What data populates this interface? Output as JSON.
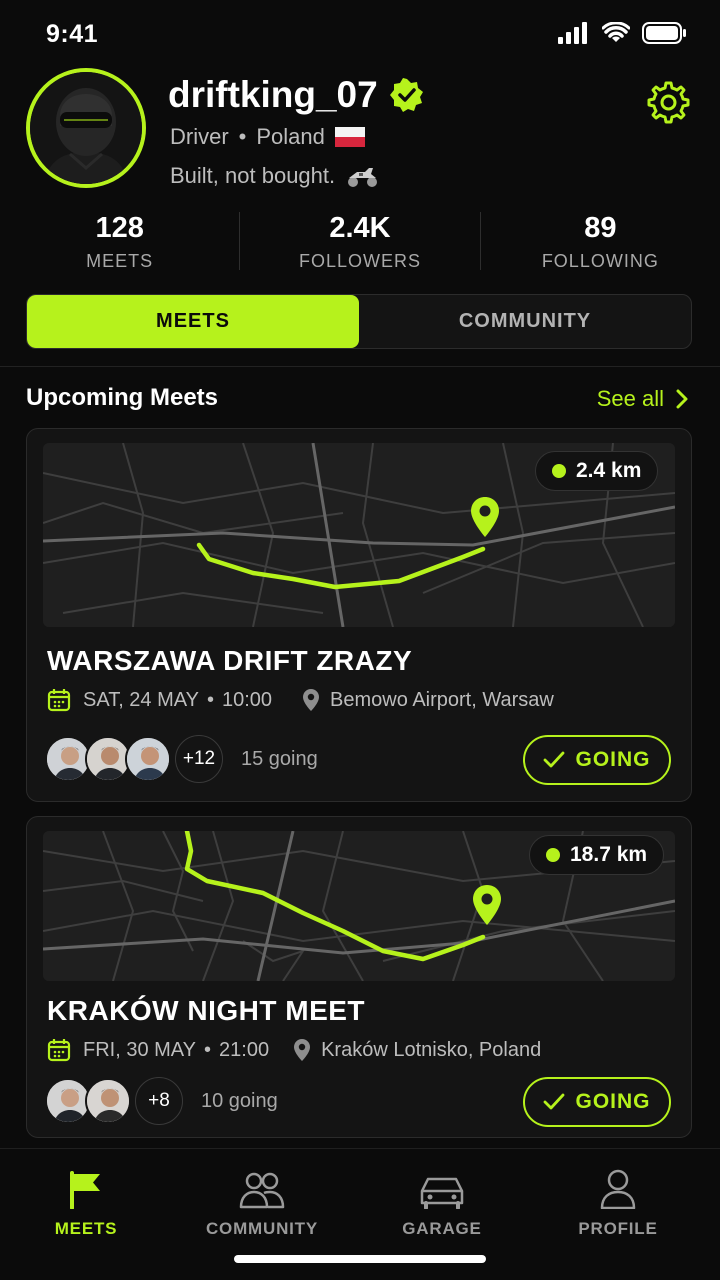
{
  "status_bar": {
    "time": "9:41"
  },
  "profile": {
    "username": "driftking_07",
    "role": "Driver",
    "country": "Poland",
    "bio": "Built, not bought."
  },
  "stats": [
    {
      "value": "128",
      "label": "MEETS"
    },
    {
      "value": "2.4K",
      "label": "FOLLOWERS"
    },
    {
      "value": "89",
      "label": "FOLLOWING"
    }
  ],
  "tabs": [
    {
      "label": "MEETS",
      "active": true
    },
    {
      "label": "COMMUNITY",
      "active": false
    }
  ],
  "section": {
    "title": "Upcoming Meets",
    "see_all": "See all"
  },
  "meets": [
    {
      "distance": "2.4 km",
      "title": "WARSZAWA DRIFT ZRAZY",
      "date": "SAT, 24 MAY",
      "time": "10:00",
      "location": "Bemowo Airport, Warsaw",
      "extra_count": "+12",
      "going_text": "15 going",
      "button": "GOING"
    },
    {
      "distance": "18.7 km",
      "title": "KRAKÓW NIGHT MEET",
      "date": "FRI, 30 MAY",
      "time": "21:00",
      "location": "Kraków Lotnisko, Poland",
      "extra_count": "+8",
      "going_text": "10 going",
      "button": "GOING"
    }
  ],
  "nav": [
    {
      "label": "MEETS",
      "icon": "flag-icon",
      "active": true
    },
    {
      "label": "COMMUNITY",
      "icon": "people-icon",
      "active": false
    },
    {
      "label": "GARAGE",
      "icon": "car-icon",
      "active": false
    },
    {
      "label": "PROFILE",
      "icon": "person-icon",
      "active": false
    }
  ],
  "colors": {
    "accent": "#b6f21c",
    "background": "#0b0b0b",
    "card": "#141414"
  }
}
